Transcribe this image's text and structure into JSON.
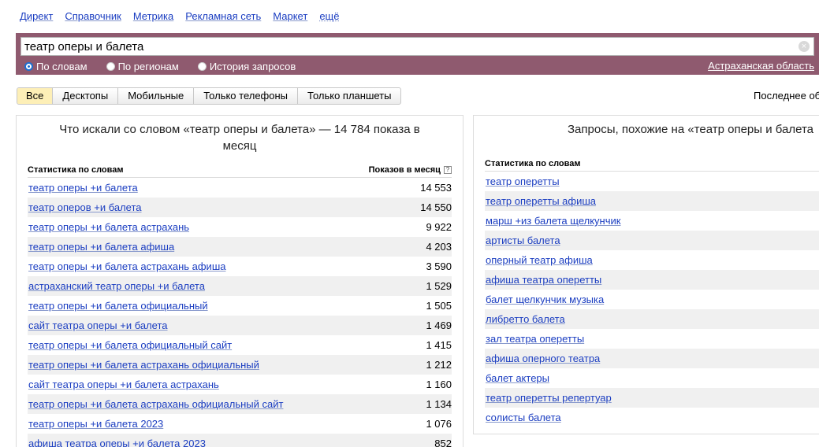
{
  "nav": [
    "Директ",
    "Справочник",
    "Метрика",
    "Рекламная сеть",
    "Маркет",
    "ещё"
  ],
  "search": {
    "value": "театр оперы и балета",
    "clear_icon": "×",
    "modes": [
      {
        "label": "По словам",
        "checked": true
      },
      {
        "label": "По регионам",
        "checked": false
      },
      {
        "label": "История запросов",
        "checked": false
      }
    ],
    "region": "Астраханская область"
  },
  "tabs": [
    {
      "label": "Все",
      "active": true
    },
    {
      "label": "Десктопы",
      "active": false
    },
    {
      "label": "Мобильные",
      "active": false
    },
    {
      "label": "Только телефоны",
      "active": false
    },
    {
      "label": "Только планшеты",
      "active": false
    }
  ],
  "last_updated": "Последнее об",
  "left": {
    "title": "Что искали со словом «театр оперы и балета» — 14 784 показа в месяц",
    "col_words": "Статистика по словам",
    "col_shows": "Показов в месяц",
    "help": "?",
    "rows": [
      {
        "phrase": "театр оперы +и балета",
        "count": "14 553"
      },
      {
        "phrase": "театр оперов +и балета",
        "count": "14 550"
      },
      {
        "phrase": "театр оперы +и балета астрахань",
        "count": "9 922"
      },
      {
        "phrase": "театр оперы +и балета афиша",
        "count": "4 203"
      },
      {
        "phrase": "театр оперы +и балета астрахань афиша",
        "count": "3 590"
      },
      {
        "phrase": "астраханский театр оперы +и балета",
        "count": "1 529"
      },
      {
        "phrase": "театр оперы +и балета официальный",
        "count": "1 505"
      },
      {
        "phrase": "сайт театра оперы +и балета",
        "count": "1 469"
      },
      {
        "phrase": "театр оперы +и балета официальный сайт",
        "count": "1 415"
      },
      {
        "phrase": "театр оперы +и балета астрахань официальный",
        "count": "1 212"
      },
      {
        "phrase": "сайт театра оперы +и балета астрахань",
        "count": "1 160"
      },
      {
        "phrase": "театр оперы +и балета астрахань официальный сайт",
        "count": "1 134"
      },
      {
        "phrase": "театр оперы +и балета 2023",
        "count": "1 076"
      },
      {
        "phrase": "афиша театра оперы +и балета 2023",
        "count": "852"
      }
    ]
  },
  "right": {
    "title": "Запросы, похожие на «театр оперы и балета",
    "col_words": "Статистика по словам",
    "rows": [
      "театр оперетты",
      "театр оперетты афиша",
      "марш +из балета щелкунчик",
      "артисты балета",
      "оперный театр афиша",
      "афиша театра оперетты",
      "балет щелкунчик музыка",
      "либретто балета",
      "зал театра оперетты",
      "афиша оперного театра",
      "балет актеры",
      "театр оперетты репертуар",
      "солисты балета"
    ]
  }
}
